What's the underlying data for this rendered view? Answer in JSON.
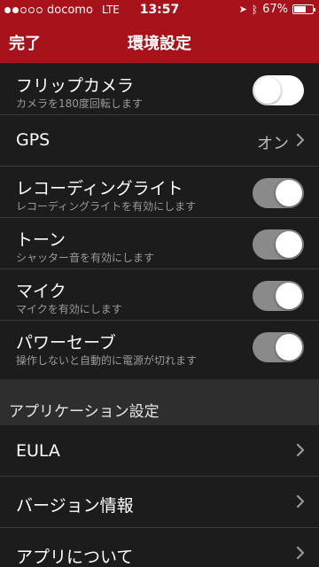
{
  "status": {
    "carrier": "docomo",
    "network": "LTE",
    "time": "13:57",
    "battery": "67%",
    "battery_level": 0.67,
    "signal_bars_filled": 2
  },
  "nav": {
    "done": "完了",
    "title": "環境設定"
  },
  "settings": {
    "flip_camera": {
      "title": "フリップカメラ",
      "sub": "カメラを180度回転します",
      "state": "off"
    },
    "gps": {
      "title": "GPS",
      "value": "オン"
    },
    "recording_light": {
      "title": "レコーディングライト",
      "sub": "レコーディングライトを有効にします",
      "state": "on"
    },
    "tone": {
      "title": "トーン",
      "sub": "シャッター音を有効にします",
      "state": "on"
    },
    "mic": {
      "title": "マイク",
      "sub": "マイクを有効にします",
      "state": "on"
    },
    "power_save": {
      "title": "パワーセーブ",
      "sub": "操作しないと自動的に電源が切れます",
      "state": "on"
    }
  },
  "app_section": {
    "title": "アプリケーション設定",
    "items": [
      "EULA",
      "バージョン情報",
      "アプリについて"
    ]
  },
  "colors": {
    "brand_red": "#a8121a",
    "background": "#1c1c1c",
    "section_bg": "#2e2e2e"
  }
}
